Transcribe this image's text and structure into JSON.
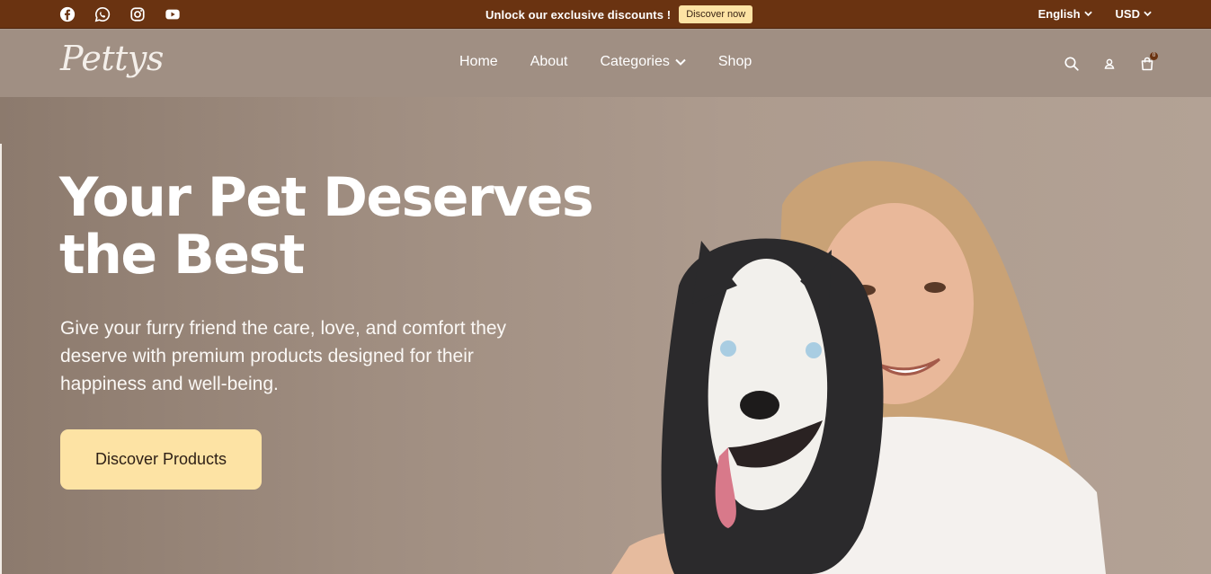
{
  "topbar": {
    "social_icons": [
      "facebook-icon",
      "whatsapp-icon",
      "instagram-icon",
      "youtube-icon"
    ],
    "promo_text": "Unlock our exclusive discounts !",
    "promo_button": "Discover now",
    "language": "English",
    "currency": "USD",
    "colors": {
      "background": "#6a3311",
      "button": "#fde3a4"
    }
  },
  "header": {
    "logo": "Pettys",
    "nav": [
      {
        "label": "Home"
      },
      {
        "label": "About"
      },
      {
        "label": "Categories",
        "has_dropdown": true
      },
      {
        "label": "Shop"
      }
    ],
    "icons": [
      "search-icon",
      "user-icon",
      "cart-icon"
    ],
    "cart_count": "0"
  },
  "hero": {
    "title": "Your Pet Deserves the Best",
    "subtitle": "Give your furry friend the care, love, and comfort they deserve with premium products designed for their happiness and well-being.",
    "cta": "Discover Products",
    "colors": {
      "cta_background": "#fde3a4",
      "title": "#ffffff"
    }
  }
}
